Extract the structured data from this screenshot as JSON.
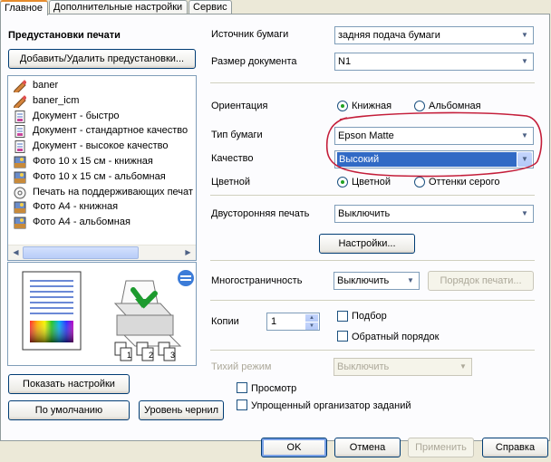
{
  "tabs": [
    {
      "label": "Главное",
      "active": true
    },
    {
      "label": "Дополнительные настройки",
      "active": false
    },
    {
      "label": "Сервис",
      "active": false
    }
  ],
  "presets": {
    "heading": "Предустановки печати",
    "add_remove_button": "Добавить/Удалить предустановки...",
    "items": [
      {
        "label": "baner",
        "icon": "pencil-icon"
      },
      {
        "label": "baner_icm",
        "icon": "pencil-icon"
      },
      {
        "label": "Документ - быстро",
        "icon": "document-icon"
      },
      {
        "label": "Документ - стандартное качество",
        "icon": "document-icon"
      },
      {
        "label": "Документ - высокое качество",
        "icon": "document-icon"
      },
      {
        "label": "Фото 10 x 15 см - книжная",
        "icon": "photo-icon"
      },
      {
        "label": "Фото 10 x 15 см - альбомная",
        "icon": "photo-icon"
      },
      {
        "label": "Печать на поддерживающих печат",
        "icon": "disc-icon"
      },
      {
        "label": "Фото А4 - книжная",
        "icon": "photo-icon"
      },
      {
        "label": "Фото А4 - альбомная",
        "icon": "photo-icon"
      }
    ]
  },
  "left_buttons": {
    "show_settings": "Показать настройки",
    "defaults": "По умолчанию",
    "ink_levels": "Уровень чернил"
  },
  "settings": {
    "paper_source": {
      "label": "Источник бумаги",
      "value": "задняя подача бумаги"
    },
    "document_size": {
      "label": "Размер документа",
      "value": "N1"
    },
    "orientation": {
      "label": "Ориентация",
      "portrait": "Книжная",
      "landscape": "Альбомная",
      "selected": "portrait"
    },
    "paper_type": {
      "label": "Тип бумаги",
      "value": "Epson Matte"
    },
    "quality": {
      "label": "Качество",
      "value": "Высокий"
    },
    "color": {
      "label": "Цветной",
      "color_option": "Цветной",
      "gray_option": "Оттенки серого",
      "selected": "color"
    },
    "duplex": {
      "label": "Двусторонняя печать",
      "value": "Выключить"
    },
    "duplex_settings_button": "Настройки...",
    "multipage": {
      "label": "Многостраничность",
      "value": "Выключить",
      "order_button": "Порядок печати..."
    },
    "copies": {
      "label": "Копии",
      "value": "1",
      "collate": "Подбор",
      "reverse": "Обратный порядок"
    },
    "quiet_mode": {
      "label": "Тихий режим",
      "value": "Выключить"
    },
    "preview": {
      "label": "Просмотр"
    },
    "job_arranger": {
      "label": "Упрощенный организатор заданий"
    }
  },
  "dialog_buttons": {
    "ok": "OK",
    "cancel": "Отмена",
    "apply": "Применить",
    "help": "Справка"
  },
  "collate_page_numbers": [
    "1",
    "1",
    "2",
    "2",
    "3",
    "3"
  ],
  "colors": {
    "annotation_red": "#c41e3a",
    "selection_blue": "#316ac5",
    "xp_tab_orange": "#e68b2c"
  }
}
